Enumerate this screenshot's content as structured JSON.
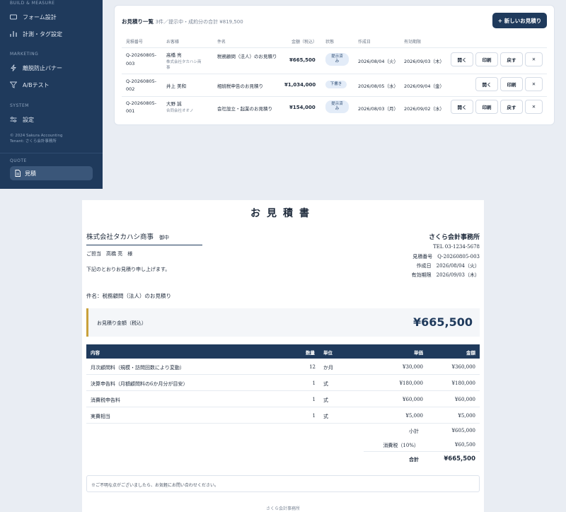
{
  "sidebar": {
    "build_section": "BUILD & MEASURE",
    "items_build": [
      {
        "label": "フォーム設計",
        "icon": "form-icon"
      },
      {
        "label": "計測・タグ設定",
        "icon": "tag-icon"
      }
    ],
    "marketing_section": "MARKETING",
    "items_marketing": [
      {
        "label": "離脱防止バナー",
        "icon": "bolt-icon"
      },
      {
        "label": "A/Bテスト",
        "icon": "filter-icon"
      }
    ],
    "system_section": "SYSTEM",
    "items_system": [
      {
        "label": "設定",
        "icon": "sliders-icon"
      }
    ],
    "copyright": "© 2024 Sakura Accounting",
    "tenant": "Tenant: さくら会計事務所",
    "quote_section": "QUOTE",
    "active_item": {
      "label": "見積",
      "icon": "document-icon"
    }
  },
  "quote_list": {
    "title": "お見積り一覧",
    "subtitle": "3件／提示中・成約分の合計 ¥819,500",
    "new_button": "+ 新しいお見積り",
    "columns": [
      "見積番号",
      "お客様",
      "件名",
      "金額（税込）",
      "状態",
      "作成日",
      "有効期限"
    ],
    "rows": [
      {
        "number_l1": "Q-20260805-",
        "number_l2": "003",
        "customer": "高橋 亮",
        "company_l1": "株式会社タカハシ商",
        "company_l2": "事",
        "subject": "税務顧問（法人）のお見積り",
        "amount": "¥665,500",
        "status_l1": "提示済",
        "status_l2": "み",
        "created": "2026/08/04（火）",
        "expires": "2026/09/03（木）",
        "actions": [
          "開く",
          "印刷",
          "戻す",
          "✕"
        ]
      },
      {
        "number_l1": "Q-20260805-",
        "number_l2": "002",
        "customer": "井上 美和",
        "company_l1": "",
        "company_l2": "",
        "subject": "相続税申告のお見積り",
        "amount": "¥1,034,000",
        "status_l1": "下書き",
        "status_l2": "",
        "created": "2026/08/05（水）",
        "expires": "2026/09/04（金）",
        "actions": [
          "開く",
          "印刷",
          "✕"
        ]
      },
      {
        "number_l1": "Q-20260805-",
        "number_l2": "001",
        "customer": "大野 誠",
        "company_l1": "合同会社オオノ",
        "company_l2": "",
        "subject": "会社設立・起業のお見積り",
        "amount": "¥154,000",
        "status_l1": "提示済",
        "status_l2": "み",
        "created": "2026/08/03（月）",
        "expires": "2026/09/02（水）",
        "actions": [
          "開く",
          "印刷",
          "戻す",
          "✕"
        ]
      }
    ]
  },
  "document": {
    "title": "お見積書",
    "client": "株式会社タカハシ商事",
    "onchu": "御中",
    "attention": "ご担当　高橋 亮　様",
    "greeting": "下記のとおりお見積り申し上げます。",
    "subject": "件名：税務顧問（法人）のお見積り",
    "issuer_name": "さくら会計事務所",
    "tel": "TEL 03-1234-5678",
    "quote_no": "見積番号　Q-20260805-003",
    "created": "作成日　2026/08/04（火）",
    "expires": "有効期限　2026/09/03（木）",
    "amount_label": "お見積り金額（税込）",
    "amount_value": "¥665,500",
    "table_headers": {
      "desc": "内容",
      "qty": "数量",
      "unit": "単位",
      "price": "単価",
      "amount": "金額"
    },
    "lines": [
      {
        "desc": "月次顧問料（規模・訪問回数により変動）",
        "qty": "12",
        "unit": "か月",
        "price": "¥30,000",
        "amount": "¥360,000"
      },
      {
        "desc": "決算申告料（月額顧問料の6か月分が目安）",
        "qty": "1",
        "unit": "式",
        "price": "¥180,000",
        "amount": "¥180,000"
      },
      {
        "desc": "消費税申告料",
        "qty": "1",
        "unit": "式",
        "price": "¥60,000",
        "amount": "¥60,000"
      },
      {
        "desc": "実費相当",
        "qty": "1",
        "unit": "式",
        "price": "¥5,000",
        "amount": "¥5,000"
      }
    ],
    "subtotal_label": "小計",
    "subtotal": "¥605,000",
    "tax_label": "消費税（10%）",
    "tax": "¥60,500",
    "total_label": "合計",
    "total": "¥665,500",
    "note": "※ご不明な点がございましたら、お気軽にお問い合わせください。",
    "footer": "さくら会計事務所"
  }
}
